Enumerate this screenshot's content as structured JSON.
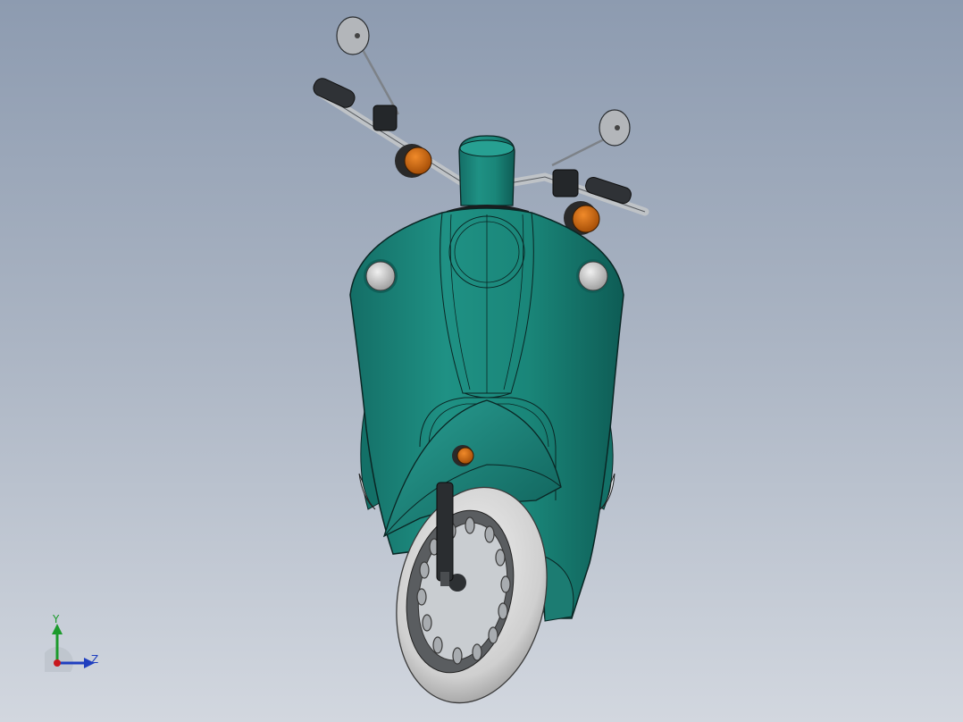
{
  "viewport": {
    "title": "",
    "model": "scooter",
    "colors": {
      "background_top": "#8d9bb0",
      "background_bottom": "#d2d7df",
      "body": "#1e8a7f",
      "body_dark": "#0f5e58",
      "edge": "#0a2624",
      "chrome": "#c9ccd0",
      "tire": "#dcdcdc",
      "indicator": "#c8650f"
    }
  },
  "triad": {
    "y_label": "Y",
    "z_label": "Z",
    "y_color": "#1c9a2c",
    "z_color": "#1f3fbf",
    "x_color": "#c8181e"
  }
}
